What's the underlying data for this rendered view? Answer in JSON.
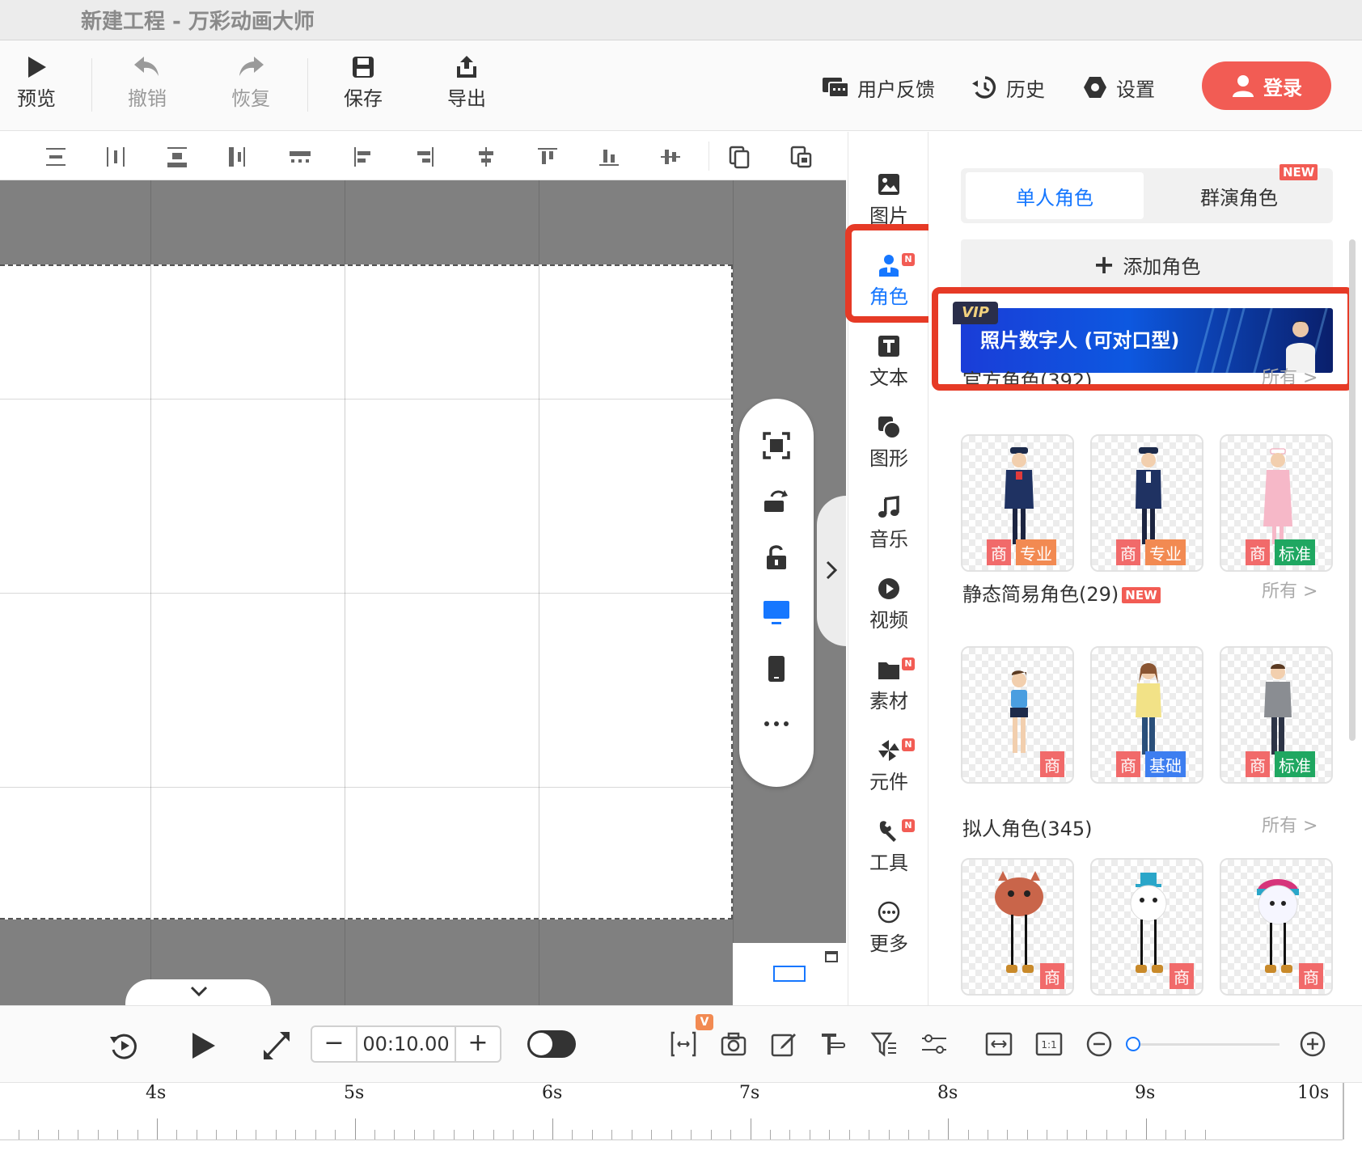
{
  "window": {
    "title": "新建工程 - 万彩动画大师"
  },
  "toolbar": {
    "preview": "预览",
    "undo": "撤销",
    "redo": "恢复",
    "save": "保存",
    "export": "导出",
    "feedback": "用户反馈",
    "history": "历史",
    "settings": "设置",
    "login": "登录"
  },
  "sidenav": {
    "items": [
      {
        "label": "图片",
        "icon": "image-icon"
      },
      {
        "label": "角色",
        "icon": "person-icon",
        "badge": "N",
        "active": true
      },
      {
        "label": "文本",
        "icon": "text-icon"
      },
      {
        "label": "图形",
        "icon": "shape-icon"
      },
      {
        "label": "音乐",
        "icon": "music-icon"
      },
      {
        "label": "视频",
        "icon": "video-icon"
      },
      {
        "label": "素材",
        "icon": "folder-icon",
        "badge": "N"
      },
      {
        "label": "元件",
        "icon": "pinwheel-icon",
        "badge": "N"
      },
      {
        "label": "工具",
        "icon": "wrench-icon",
        "badge": "N"
      },
      {
        "label": "更多",
        "icon": "more-icon"
      }
    ]
  },
  "panel": {
    "tabs": {
      "single": "单人角色",
      "group": "群演角色",
      "group_badge": "NEW"
    },
    "add_role": "添加角色",
    "vip": {
      "tag": "VIP",
      "text": "照片数字人 (可对口型)"
    },
    "sections": [
      {
        "title": "官方角色(392)",
        "all": "所有 >",
        "cards": [
          {
            "name": "policewoman",
            "tags": [
              "商",
              "专业"
            ]
          },
          {
            "name": "pilot",
            "tags": [
              "商",
              "专业"
            ]
          },
          {
            "name": "nurse",
            "tags": [
              "商",
              "标准"
            ]
          }
        ]
      },
      {
        "title": "静态简易角色(29)",
        "badge": "NEW",
        "all": "所有 >",
        "cards": [
          {
            "name": "sporty-woman",
            "tags": [
              "商"
            ]
          },
          {
            "name": "woman-yellow-jacket",
            "tags": [
              "商",
              "基础"
            ]
          },
          {
            "name": "man-grey-sweater",
            "tags": [
              "商",
              "标准"
            ]
          }
        ]
      },
      {
        "title": "拟人角色(345)",
        "all": "所有 >",
        "cards": [
          {
            "name": "brown-monster",
            "tags": [
              "商"
            ]
          },
          {
            "name": "snowman-top-hat",
            "tags": [
              "商"
            ]
          },
          {
            "name": "snowman-beanie",
            "tags": [
              "商"
            ]
          }
        ]
      }
    ]
  },
  "timeline": {
    "duration": "00:10.00",
    "v_badge": "V",
    "ticks": [
      "4s",
      "5s",
      "6s",
      "7s",
      "8s",
      "9s",
      "10s"
    ]
  },
  "colors": {
    "accent": "#1677ff",
    "login": "#f25c54",
    "highlight": "#e63a26",
    "tag_shang": "#f16a6a",
    "tag_zhuanye": "#f28a52",
    "tag_biaozhun": "#1fa761",
    "tag_jichu": "#3d7ef0"
  }
}
